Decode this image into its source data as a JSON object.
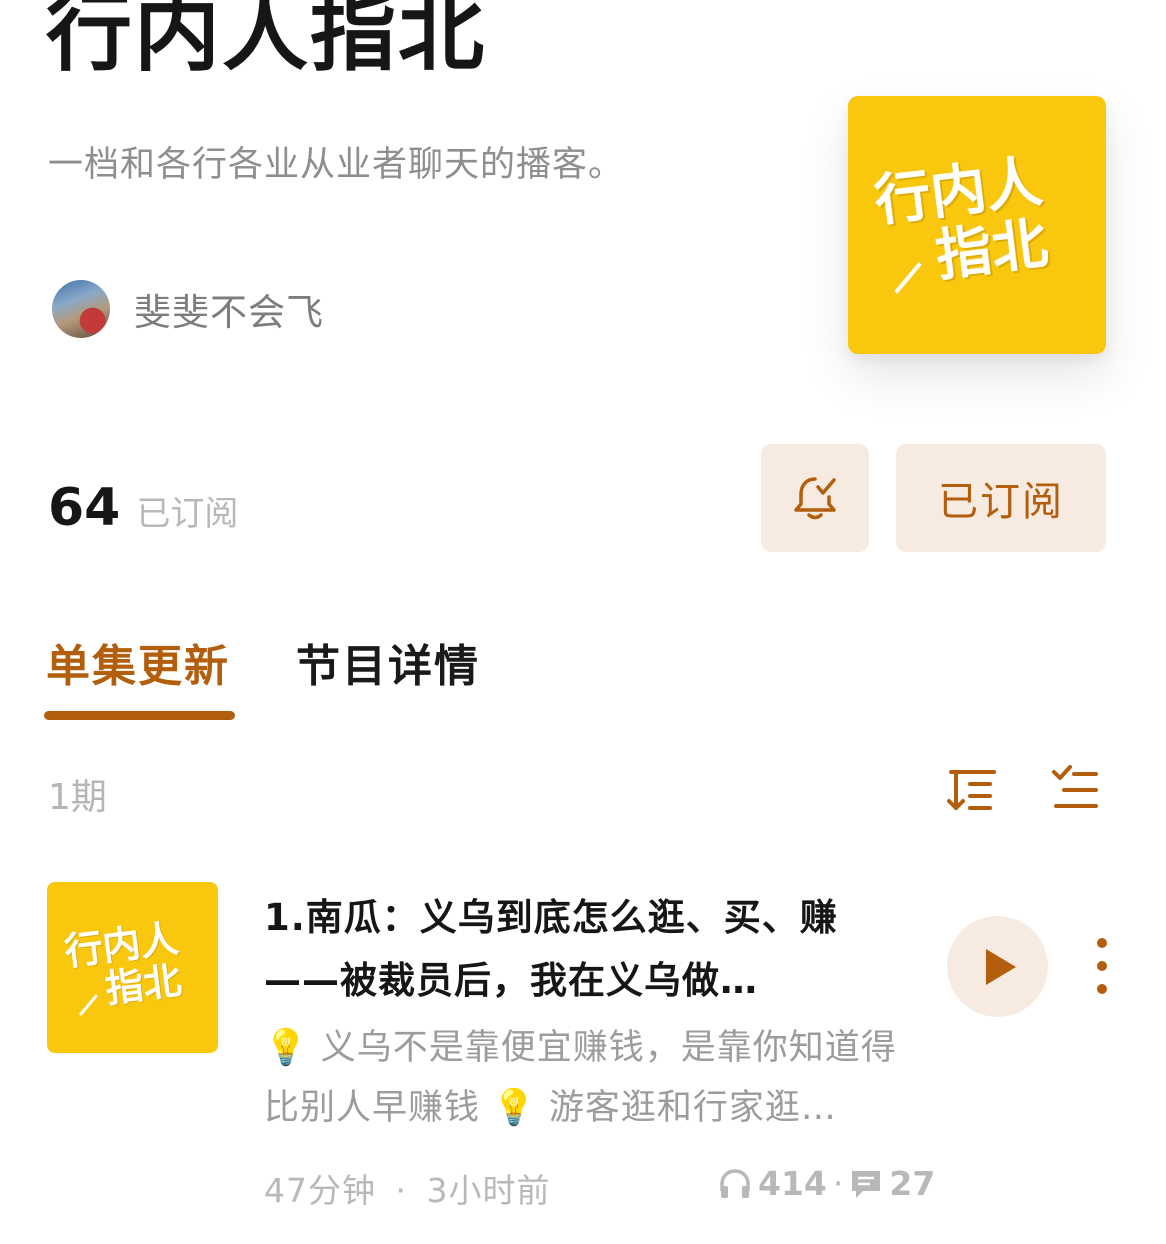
{
  "podcast": {
    "title": "行内人指北",
    "description": "一档和各行各业从业者聊天的播客。",
    "author": "斐斐不会飞",
    "cover_text_line1": "行内人",
    "cover_text_line2": "指北"
  },
  "subscription": {
    "count": "64",
    "count_label": "已订阅",
    "button_label": "已订阅"
  },
  "tabs": [
    {
      "label": "单集更新",
      "active": true
    },
    {
      "label": "节目详情",
      "active": false
    }
  ],
  "episode_list": {
    "count_label": "1期",
    "episodes": [
      {
        "title": "1.南瓜：义乌到底怎么逛、买、赚——被裁员后，我在义乌做…",
        "description": "💡 义乌不是靠便宜赚钱，是靠你知道得比别人早赚钱 💡 游客逛和行家逛…",
        "duration": "47分钟",
        "separator": "·",
        "published": "3小时前",
        "plays": "414",
        "stats_separator": "·",
        "comments": "27"
      }
    ]
  },
  "colors": {
    "accent": "#b25e0c",
    "accent_bg": "#f7ebe1",
    "cover_yellow": "#f9c80e"
  },
  "icons": {
    "bell": "bell-check-icon",
    "sort": "sort-icon",
    "filter": "checklist-icon",
    "play": "play-icon",
    "more": "more-vertical-icon",
    "headphones": "headphones-icon",
    "comment": "comment-icon"
  }
}
